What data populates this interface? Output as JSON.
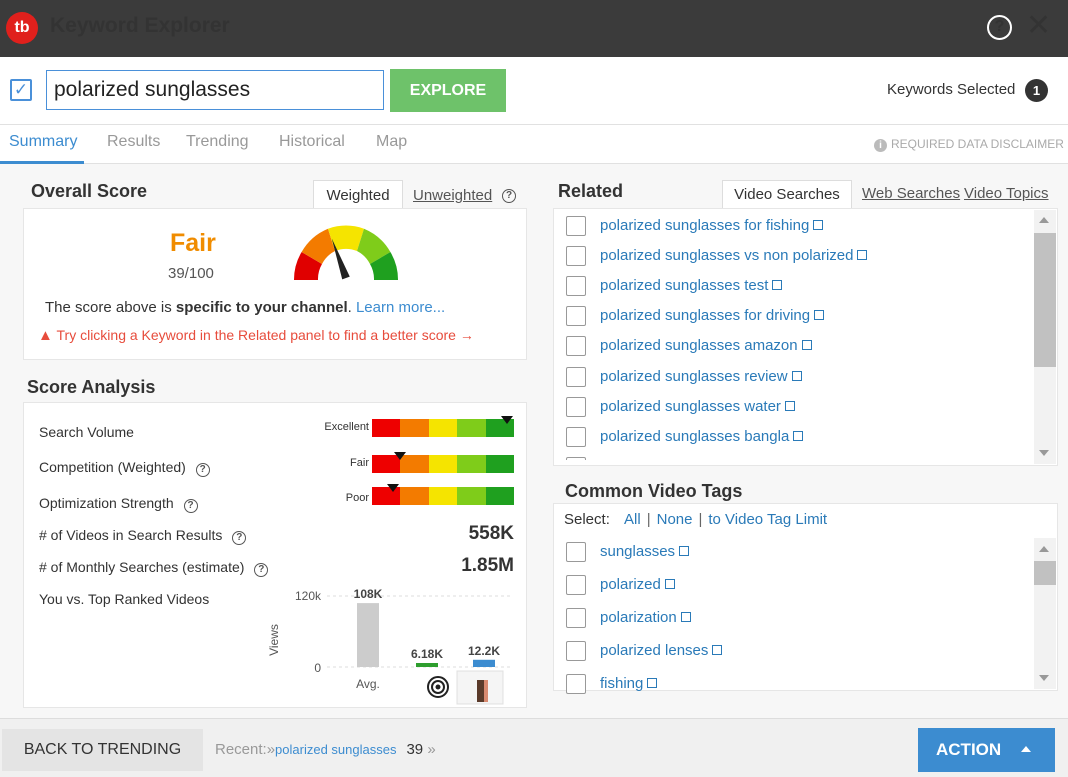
{
  "app": {
    "logo": "tb",
    "title": "Keyword Explorer"
  },
  "search": {
    "value": "polarized sunglasses",
    "explore_label": "EXPLORE",
    "keywords_selected_label": "Keywords Selected",
    "keywords_selected_count": "1"
  },
  "tabs": [
    "Summary",
    "Results",
    "Trending",
    "Historical",
    "Map"
  ],
  "disclaimer": "REQUIRED DATA DISCLAIMER",
  "overall": {
    "title": "Overall Score",
    "weighted_label": "Weighted",
    "unweighted_label": "Unweighted",
    "rating": "Fair",
    "score": "39/100",
    "score_value": 39,
    "specific_pre": "The score above is ",
    "specific_bold": "specific to your channel",
    "specific_post": ". ",
    "learn_more": "Learn more...",
    "warning": "Try clicking a Keyword in the Related panel to find a better score →"
  },
  "analysis": {
    "title": "Score Analysis",
    "rows": [
      {
        "label": "Search Volume",
        "level_label": "Excellent",
        "level": 0.95
      },
      {
        "label": "Competition (Weighted)",
        "level_label": "Fair",
        "level": 0.2
      },
      {
        "label": "Optimization Strength",
        "level_label": "Poor",
        "level": 0.15
      }
    ],
    "videos_label": "# of Videos in Search Results",
    "videos_value": "558K",
    "monthly_label": "# of Monthly Searches (estimate)",
    "monthly_value": "1.85M",
    "you_vs_label": "You vs. Top Ranked Videos",
    "chart": {
      "ylabel": "Views",
      "ymax_label": "120k",
      "ymin_label": "0",
      "ymax": 120000,
      "bars": [
        {
          "label": "108K",
          "value": 108000,
          "xlabel": "Avg.",
          "color": "#cccccc"
        },
        {
          "label": "6.18K",
          "value": 6180,
          "xlabel": "",
          "color": "#2e9e2e"
        },
        {
          "label": "12.2K",
          "value": 12200,
          "xlabel": "",
          "color": "#3c8cd0"
        }
      ]
    }
  },
  "related": {
    "title": "Related",
    "tabs": [
      "Video Searches",
      "Web Searches",
      "Video Topics"
    ],
    "items": [
      "polarized sunglasses for fishing",
      "polarized sunglasses vs non polarized",
      "polarized sunglasses test",
      "polarized sunglasses for driving",
      "polarized sunglasses amazon",
      "polarized sunglasses review",
      "polarized sunglasses water",
      "polarized sunglasses bangla",
      "polarized sunglasses scratch repair"
    ]
  },
  "tags": {
    "title": "Common Video Tags",
    "select_label": "Select:",
    "all": "All",
    "none": "None",
    "limit": "to Video Tag Limit",
    "items": [
      "sunglasses",
      "polarized",
      "polarization",
      "polarized lenses",
      "fishing"
    ]
  },
  "footer": {
    "back_label": "BACK TO TRENDING",
    "recent_label": "Recent:»",
    "recent_keyword": "polarized sunglasses",
    "recent_score": "39",
    "recent_more": "»",
    "action_label": "ACTION"
  },
  "colors": {
    "accent": "#3c8cd0",
    "explore": "#6ec26a",
    "fair": "#f08c00",
    "warning": "#e74c3c"
  }
}
